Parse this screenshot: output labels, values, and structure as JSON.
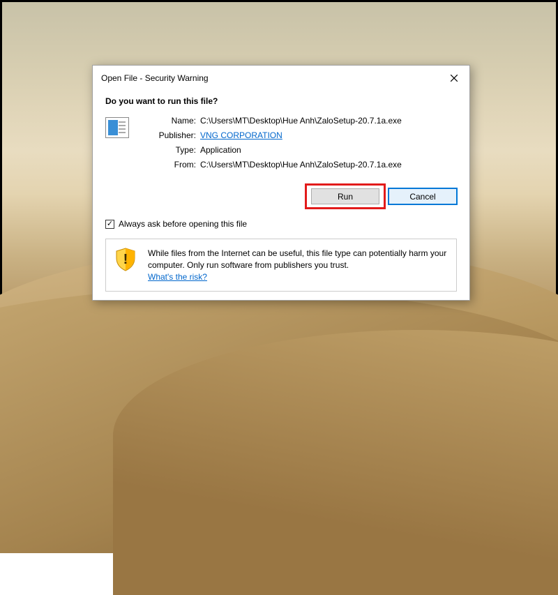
{
  "dialog": {
    "title": "Open File - Security Warning",
    "heading": "Do you want to run this file?",
    "fields": {
      "name_label": "Name:",
      "name_value": "C:\\Users\\MT\\Desktop\\Hue Anh\\ZaloSetup-20.7.1a.exe",
      "publisher_label": "Publisher:",
      "publisher_value": "VNG CORPORATION",
      "type_label": "Type:",
      "type_value": "Application",
      "from_label": "From:",
      "from_value": "C:\\Users\\MT\\Desktop\\Hue Anh\\ZaloSetup-20.7.1a.exe"
    },
    "buttons": {
      "run": "Run",
      "cancel": "Cancel"
    },
    "checkbox_label": "Always ask before opening this file",
    "footer": {
      "text": "While files from the Internet can be useful, this file type can potentially harm your computer. Only run software from publishers you trust.",
      "link": "What's the risk?"
    }
  }
}
